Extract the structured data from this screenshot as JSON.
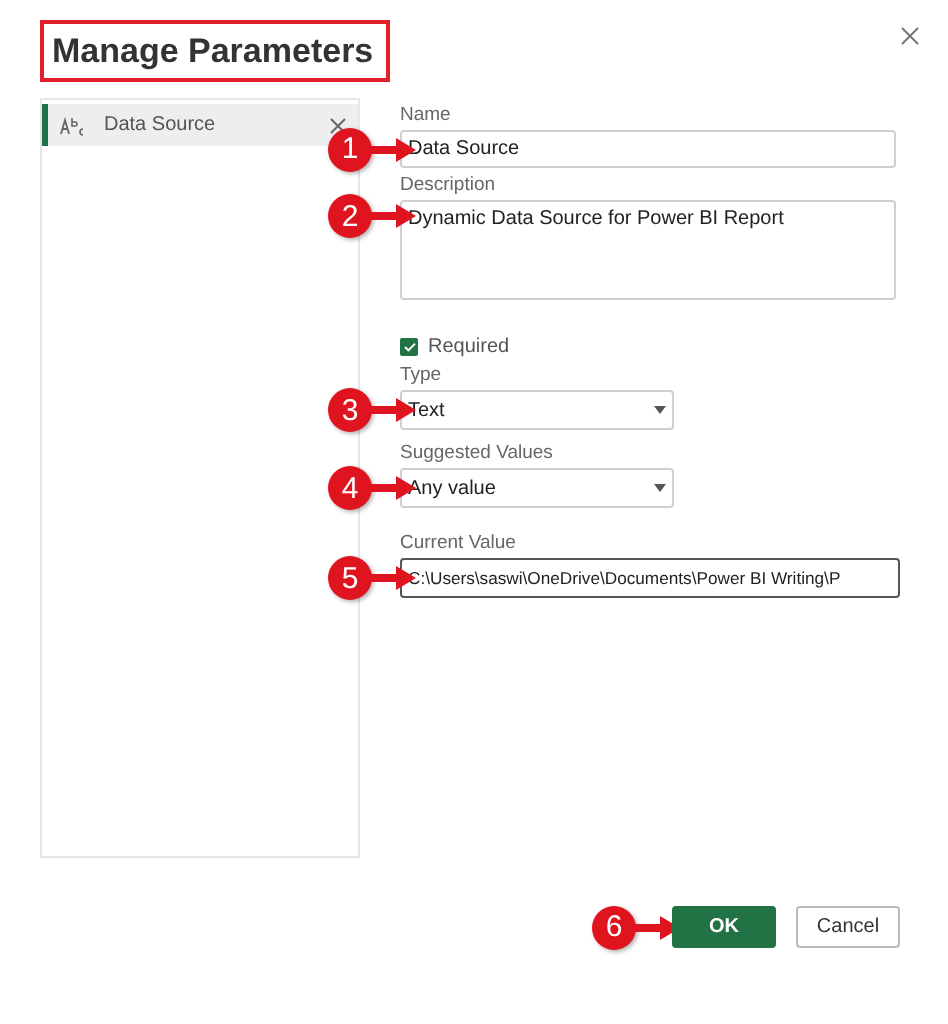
{
  "dialog": {
    "title": {
      "text": "Manage Parameters",
      "highlighted": true
    }
  },
  "parameters": [
    {
      "name": "Data Source",
      "selected": true
    }
  ],
  "form": {
    "name": {
      "label": "Name",
      "value": "Data Source",
      "callout": "1"
    },
    "description": {
      "label": "Description",
      "value": "Dynamic Data Source for Power BI Report",
      "callout": "2"
    },
    "required": {
      "label": "Required",
      "checked": true
    },
    "type": {
      "label": "Type",
      "value": "Text",
      "callout": "3"
    },
    "suggested_values": {
      "label": "Suggested Values",
      "value": "Any value",
      "callout": "4"
    },
    "current_value": {
      "label": "Current Value",
      "value": "C:\\Users\\saswi\\OneDrive\\Documents\\Power BI Writing\\P",
      "callout": "5"
    }
  },
  "buttons": [
    {
      "kind": "primary",
      "label": "OK",
      "callout": "6"
    },
    {
      "kind": "secondary",
      "label": "Cancel"
    }
  ]
}
